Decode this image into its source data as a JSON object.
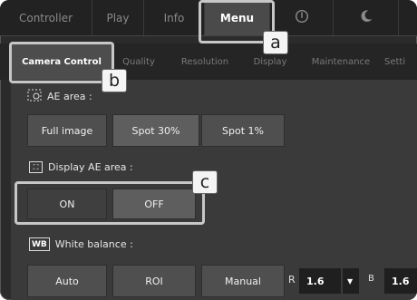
{
  "top_tabs": {
    "controller": "Controller",
    "play": "Play",
    "info": "Info",
    "menu": "Menu"
  },
  "sub_tabs": {
    "camera_control": "Camera Control",
    "quality": "Quality",
    "resolution": "Resolution",
    "display": "Display",
    "maintenance": "Maintenance",
    "settings": "Setti"
  },
  "ae_area": {
    "label": "AE area :",
    "options": [
      "Full image",
      "Spot 30%",
      "Spot 1%"
    ]
  },
  "display_ae_area": {
    "label": "Display AE area :",
    "on": "ON",
    "off": "OFF"
  },
  "white_balance": {
    "icon_text": "WB",
    "label": "White balance :",
    "options": [
      "Auto",
      "ROI",
      "Manual"
    ],
    "r_label": "R",
    "r_value": "1.6",
    "b_label": "B",
    "b_value": "1.6"
  },
  "callouts": {
    "a": "a",
    "b": "b",
    "c": "c"
  },
  "colors": {
    "background": "#2b2b2b",
    "panel": "#3a3a3a",
    "active_tab": "#4a4a4a",
    "highlight": "#c7c7c7"
  }
}
